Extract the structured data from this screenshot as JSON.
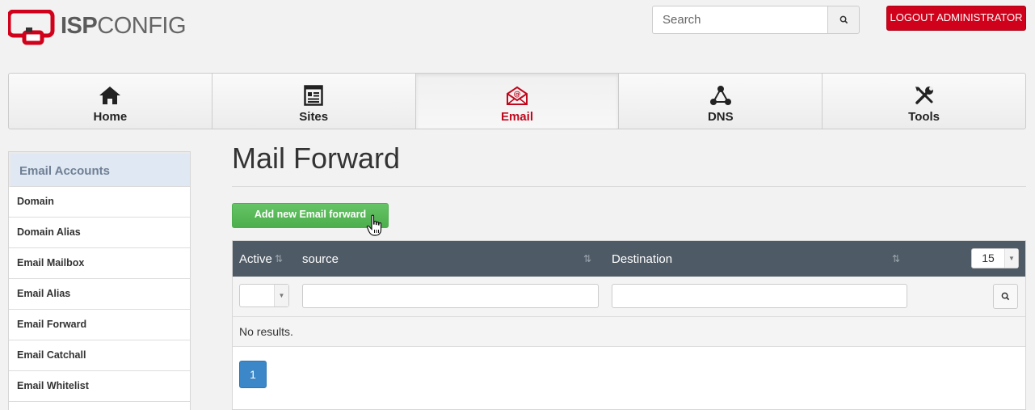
{
  "header": {
    "logo_bold": "ISP",
    "logo_light": "CONFIG",
    "search_placeholder": "Search",
    "logout_label": "LOGOUT ADMINISTRATOR"
  },
  "topnav": {
    "tabs": [
      {
        "label": "Home",
        "icon": "home-icon"
      },
      {
        "label": "Sites",
        "icon": "sites-icon"
      },
      {
        "label": "Email",
        "icon": "email-icon",
        "active": true
      },
      {
        "label": "DNS",
        "icon": "dns-icon"
      },
      {
        "label": "Tools",
        "icon": "tools-icon"
      }
    ]
  },
  "sidebar": {
    "heading": "Email Accounts",
    "items": [
      {
        "label": "Domain"
      },
      {
        "label": "Domain Alias"
      },
      {
        "label": "Email Mailbox"
      },
      {
        "label": "Email Alias"
      },
      {
        "label": "Email Forward"
      },
      {
        "label": "Email Catchall"
      },
      {
        "label": "Email Whitelist"
      }
    ]
  },
  "main": {
    "title": "Mail Forward",
    "add_button_label": "Add new Email forward",
    "table": {
      "columns": [
        "Active",
        "source",
        "Destination"
      ],
      "per_page": "15",
      "empty_text": "No results.",
      "current_page": "1"
    }
  },
  "colors": {
    "brand_red": "#d0021b",
    "header_dark": "#4e5a65",
    "add_green": "#5cb85c",
    "pager_blue": "#3b87c8"
  }
}
